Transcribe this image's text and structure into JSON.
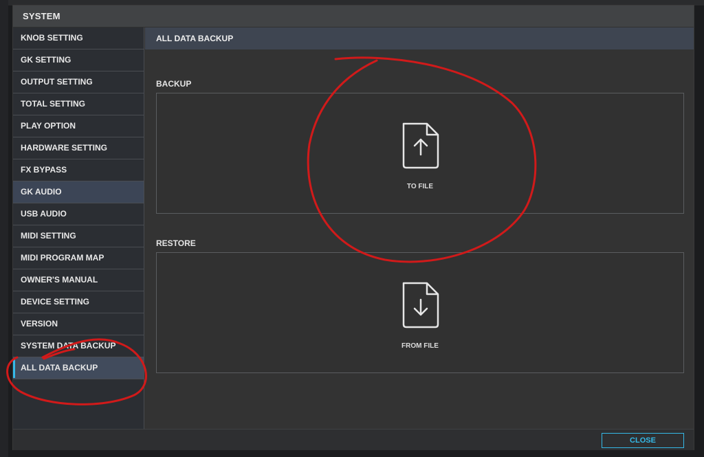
{
  "dialog": {
    "title": "SYSTEM"
  },
  "sidebar": {
    "items": [
      {
        "label": "KNOB SETTING"
      },
      {
        "label": "GK SETTING"
      },
      {
        "label": "OUTPUT SETTING"
      },
      {
        "label": "TOTAL SETTING"
      },
      {
        "label": "PLAY OPTION"
      },
      {
        "label": "HARDWARE SETTING"
      },
      {
        "label": "FX BYPASS"
      },
      {
        "label": "GK AUDIO"
      },
      {
        "label": "USB AUDIO"
      },
      {
        "label": "MIDI SETTING"
      },
      {
        "label": "MIDI PROGRAM MAP"
      },
      {
        "label": "OWNER'S MANUAL"
      },
      {
        "label": "DEVICE SETTING"
      },
      {
        "label": "VERSION"
      },
      {
        "label": "SYSTEM DATA BACKUP"
      },
      {
        "label": "ALL DATA BACKUP"
      }
    ],
    "active_item": "ALL DATA BACKUP",
    "highlighted_item": "GK AUDIO"
  },
  "content": {
    "header": "ALL DATA BACKUP",
    "backup": {
      "label": "BACKUP",
      "caption": "TO FILE",
      "icon": "file-upload-icon"
    },
    "restore": {
      "label": "RESTORE",
      "caption": "FROM FILE",
      "icon": "file-download-icon"
    }
  },
  "footer": {
    "close_label": "CLOSE"
  },
  "colors": {
    "accent": "#35b9e8",
    "annotation": "#d11a1a",
    "panel": "#333333",
    "sidebar": "#2b2e33"
  }
}
